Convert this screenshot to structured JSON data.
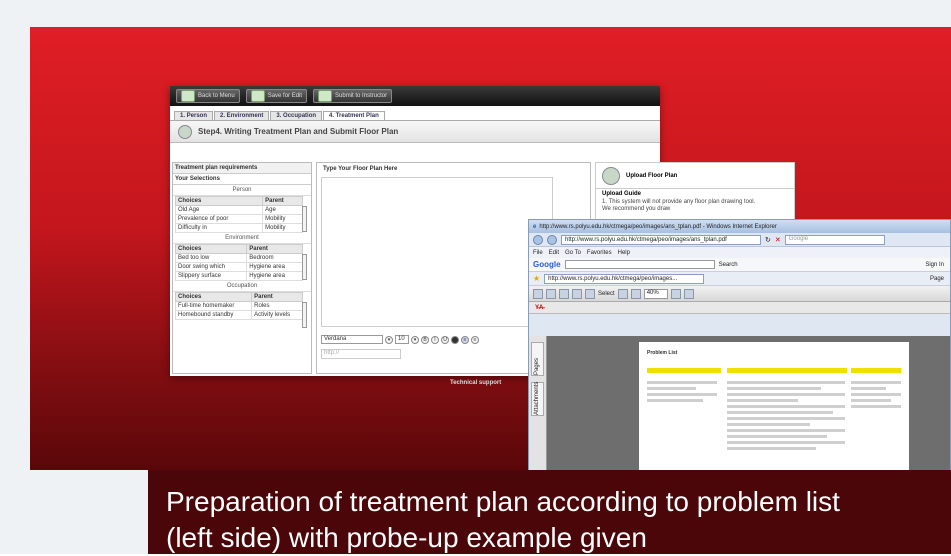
{
  "caption": {
    "line1": "Preparation of treatment plan according to problem list",
    "line2": "(left side) with probe-up example given"
  },
  "app": {
    "toolbar": [
      "Back to Menu",
      "Save for Edit",
      "Submit to Instructor"
    ],
    "tabs": [
      "1. Person",
      "2. Environment",
      "3. Occupation",
      "4. Treatment Plan"
    ],
    "step_title": "Step4. Writing Treatment Plan and Submit Floor Plan",
    "left": {
      "header": "Treatment plan requirements",
      "sub": "Your Selections",
      "sections": [
        {
          "title": "Person",
          "rows": [
            [
              "Old Age",
              "Age"
            ],
            [
              "Prevalence of poor",
              "Mobility"
            ],
            [
              "Difficulty in",
              "Mobility"
            ]
          ]
        },
        {
          "title": "Environment",
          "rows": [
            [
              "Bed too low",
              "Bedroom"
            ],
            [
              "Door swing which",
              "Hygiene area"
            ],
            [
              "Slippery surface",
              "Hygiene area"
            ]
          ]
        },
        {
          "title": "Occupation",
          "rows": [
            [
              "Full-time homemaker",
              "Roles"
            ],
            [
              "Homebound standby",
              "Activity levels"
            ]
          ]
        }
      ],
      "col_choices": "Choices",
      "col_parent": "Parent"
    },
    "mid": {
      "header": "Type Your Floor Plan Here",
      "font": "Verdana",
      "size": "10",
      "url_placeholder": "http://"
    },
    "right": {
      "upload_title": "Upload Floor Plan",
      "guide_title": "Upload Guide",
      "guide_text": "1. This system will not provide any floor plan drawing tool. We recommend you draw"
    },
    "support": "Technical support"
  },
  "ie": {
    "title": "http://www.rs.polyu.edu.hk/ctmega/peo/images/ans_tplan.pdf - Windows Internet Explorer",
    "address": "http://www.rs.polyu.edu.hk/ctmega/peo/images/ans_tplan.pdf",
    "search_placeholder": "Google",
    "menu": [
      "File",
      "Edit",
      "Go To",
      "Favorites",
      "Help"
    ],
    "google": "Google",
    "google_search": "Search",
    "fav_tab": "http://www.rs.polyu.edu.hk/ctmega/peo/images...",
    "page_btn": "Page",
    "sign_in": "Sign In",
    "select": "Select",
    "zoom": "40%",
    "side_tabs": [
      "Pages",
      "Attachments"
    ],
    "doc_title": "Problem List"
  }
}
